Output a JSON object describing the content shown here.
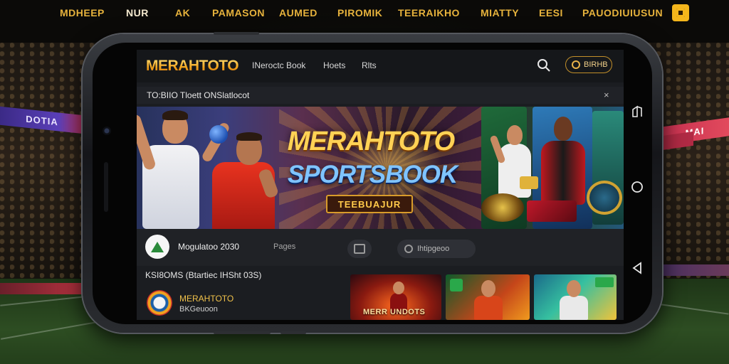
{
  "top_nav": {
    "items": [
      "MDHEEP",
      "NUR",
      "AK",
      "PAMASON",
      "AUMED",
      "PIROMIK",
      "TEERAIKHO",
      "MIATTY",
      "EESI",
      "PAUODIUIUSUN"
    ]
  },
  "stadium": {
    "left_board": "DOTIA",
    "right_board": "MAI"
  },
  "app": {
    "logo": "MERAHTOTO",
    "nav": [
      "INeroctc Book",
      "Hoets",
      "Rlts"
    ],
    "login_label": "BIRHB",
    "notice": "TO:BIIO Tloett ONSlatlocot",
    "notice_close": "×"
  },
  "banner": {
    "title_main": "MERAHTOTO",
    "title_sub": "SPORTSBOOK",
    "tag": "TEEBUAJUR"
  },
  "feed": {
    "name": "Mogulatoo 2030",
    "pages_label": "Pages",
    "chip_label": "Ihtipgeoo"
  },
  "section": {
    "title": "KSI8OMS (Btartiec IHSht 03S)"
  },
  "account": {
    "name": "MERAHTOTO",
    "sub": "BKGeuoon"
  },
  "thumbnails": [
    {
      "caption": "MERR UNDOTS"
    },
    {
      "caption": ""
    },
    {
      "caption": ""
    }
  ],
  "colors": {
    "accent": "#e6b23c",
    "logo_gold": "#f0a11a",
    "banner_blue": "#7fc4ff"
  }
}
